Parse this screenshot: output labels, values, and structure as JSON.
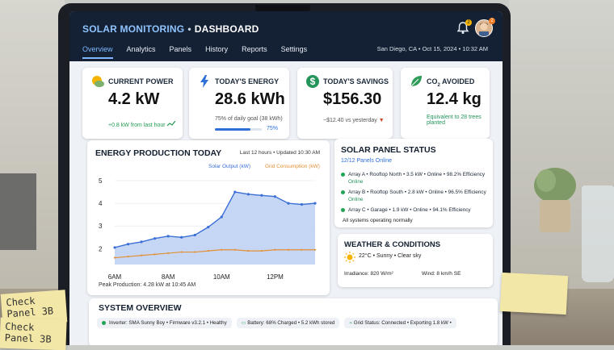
{
  "header": {
    "brand_primary": "SOLAR MONITORING",
    "brand_separator": "•",
    "brand_secondary": "DASHBOARD",
    "tabs": [
      {
        "label": "Overview",
        "active": true
      },
      {
        "label": "Analytics"
      },
      {
        "label": "Panels"
      },
      {
        "label": "History"
      },
      {
        "label": "Reports"
      },
      {
        "label": "Settings"
      }
    ],
    "location_time": "San Diego, CA • Oct 15, 2024 • 10:32 AM",
    "notification_count": "2",
    "avatar_badge": "2"
  },
  "kpis": {
    "current_power": {
      "label": "CURRENT POWER",
      "value": "4.2 kW",
      "sub": "+0.8 kW from last hour"
    },
    "todays_energy": {
      "label": "TODAY'S ENERGY",
      "value": "28.6 kWh",
      "sub": "75% of daily goal (38 kWh)",
      "progress_label": "75%",
      "progress": 0.75
    },
    "todays_savings": {
      "label": "TODAY'S SAVINGS",
      "value": "$156.30",
      "sub": "~$12.40 vs yesterday"
    },
    "co2_avoided": {
      "label_prefix": "CO",
      "label_sub": "2",
      "label_suffix": " AVOIDED",
      "value": "12.4 kg",
      "sub_line1": "Equivalent to 28 trees",
      "sub_line2": "planted"
    }
  },
  "energy_chart": {
    "title": "ENERGY PRODUCTION TODAY",
    "range": "Last 12 hours • Updated 10:30 AM",
    "peak_text": "Peak Production: 4.28 kW at 10:45 AM"
  },
  "chart_data": {
    "type": "area",
    "x": [
      6,
      6.5,
      7,
      7.5,
      8,
      8.5,
      9,
      9.5,
      10,
      10.5,
      11,
      11.5,
      12,
      12.5,
      13,
      13.5
    ],
    "xticks": [
      "6AM",
      "8AM",
      "10AM",
      "12PM"
    ],
    "xtick_values": [
      6,
      8,
      10,
      12
    ],
    "yticks": [
      "5",
      "4",
      "3",
      "2"
    ],
    "ytick_values": [
      5,
      4,
      3,
      2
    ],
    "ylim": [
      1.3,
      5
    ],
    "series": [
      {
        "name": "Solar Output (kW)",
        "color": "#3b6fd6",
        "values": [
          2.05,
          2.2,
          2.3,
          2.45,
          2.55,
          2.5,
          2.6,
          2.95,
          3.4,
          4.5,
          4.4,
          4.35,
          4.3,
          4.0,
          3.95,
          4.0
        ]
      },
      {
        "name": "Grid Consumption (kW)",
        "color": "#e39034",
        "values": [
          1.6,
          1.65,
          1.7,
          1.75,
          1.8,
          1.85,
          1.85,
          1.9,
          1.95,
          1.95,
          1.9,
          1.9,
          1.95,
          1.95,
          1.95,
          1.95
        ]
      }
    ]
  },
  "panel_status": {
    "title": "SOLAR PANEL STATUS",
    "subtitle": "12/12 Panels Online",
    "arrays": [
      {
        "line1": "Array A • Rooftop North • 3.5 kW • Online • 98.2% Efficiency",
        "line2": "Online"
      },
      {
        "line1": "Array B • Rooftop South • 2.8 kW • Online • 96.5% Efficiency",
        "line2": "Online"
      },
      {
        "line1": "Array C • Garage • 1.9 kW • Online • 94.1% Efficiency",
        "line2": ""
      }
    ],
    "footer": "All systems operating normally"
  },
  "weather": {
    "title": "WEATHER & CONDITIONS",
    "condition": "22°C • Sunny • Clear sky",
    "irradiance": "Irradiance: 820 W/m²",
    "wind": "Wind: 8 km/h SE"
  },
  "system_overview": {
    "title": "SYSTEM OVERVIEW",
    "chips": [
      {
        "text": "Inverter: SMA Sunny Boy • Firmware v3.2.1 • Healthy"
      },
      {
        "text": "Battery: 68% Charged • 5.2 kWh stored"
      },
      {
        "text": "Grid Status: Connected • Exporting 1.8 kW •"
      }
    ]
  },
  "desk_notes": {
    "note1": "Check\nPanel 3B",
    "note2": "Check\nPanel 3B"
  }
}
